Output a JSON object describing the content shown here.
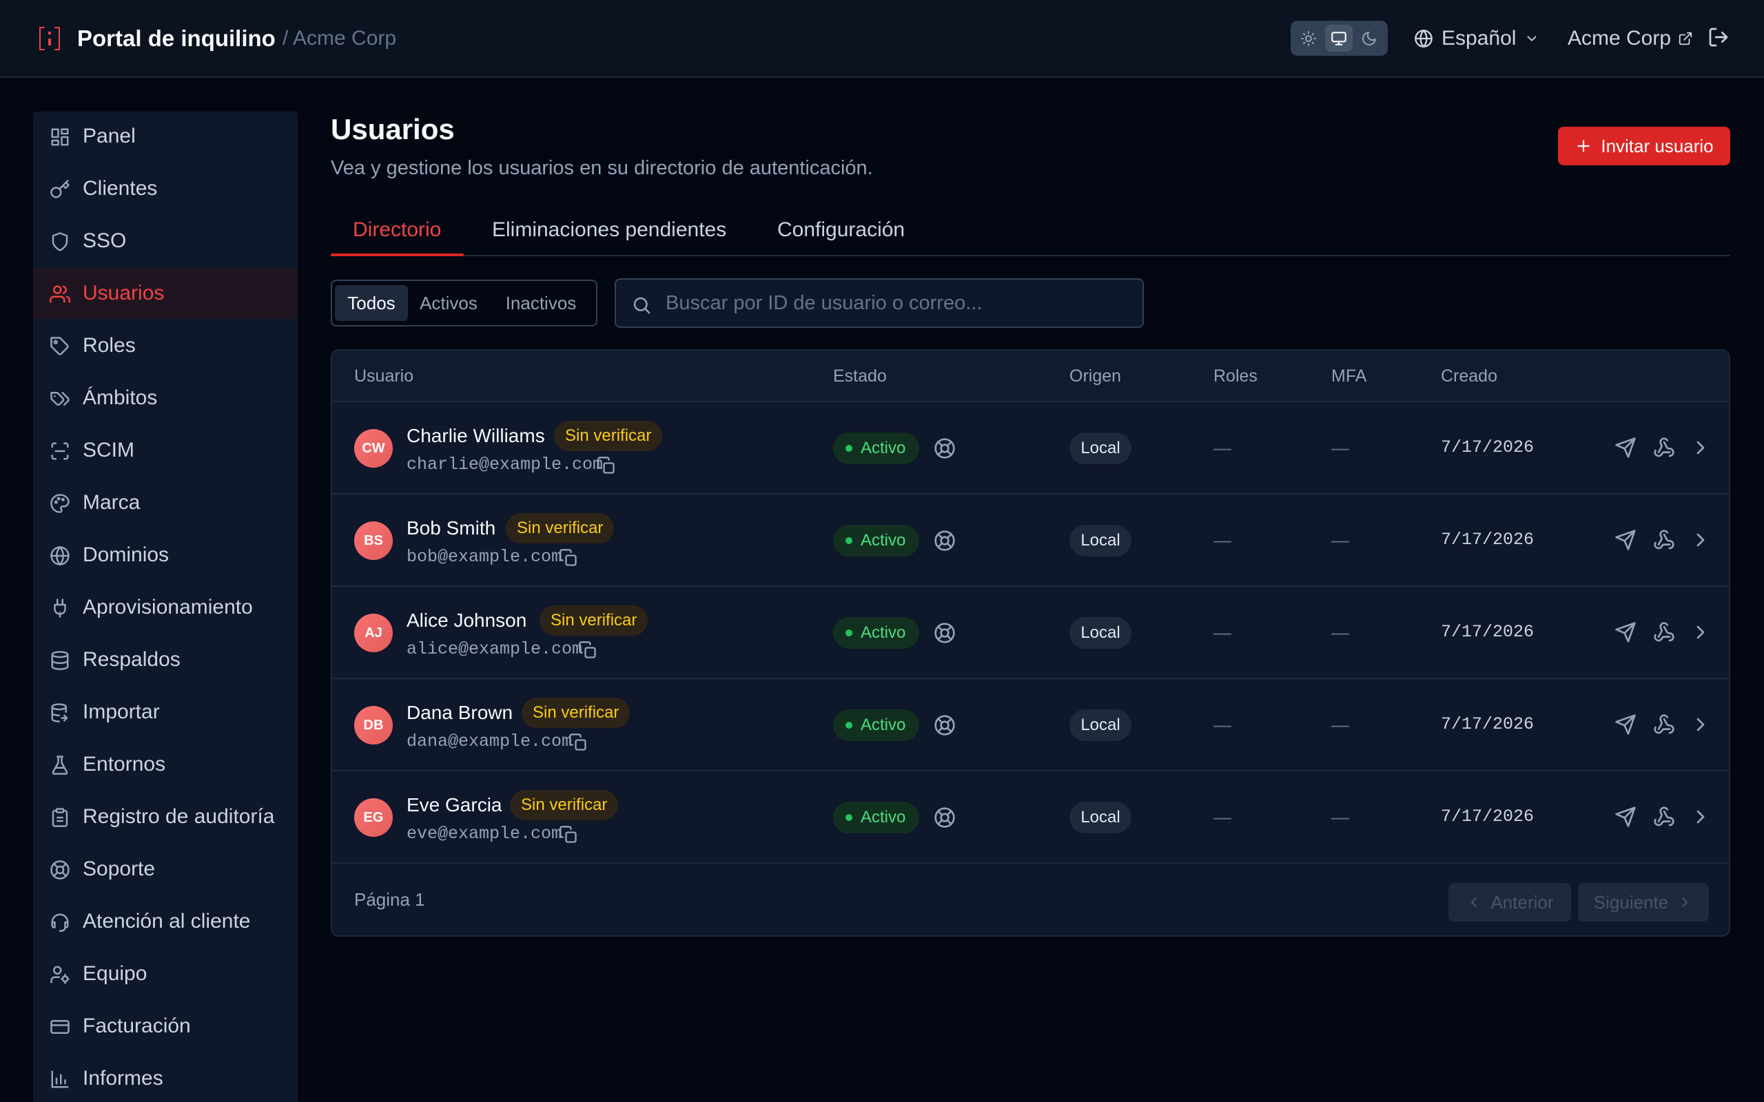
{
  "header": {
    "app_title": "Portal de inquilino",
    "breadcrumb": "/ Acme Corp",
    "theme_options": [
      "sun-icon",
      "monitor-icon",
      "moon-icon"
    ],
    "theme_selected": "monitor",
    "language": "Español",
    "org_link": "Acme Corp"
  },
  "sidebar": {
    "active": "Usuarios",
    "items": [
      {
        "label": "Panel",
        "icon": "dashboard-icon"
      },
      {
        "label": "Clientes",
        "icon": "key-icon"
      },
      {
        "label": "SSO",
        "icon": "shield-icon"
      },
      {
        "label": "Usuarios",
        "icon": "users-icon"
      },
      {
        "label": "Roles",
        "icon": "tag-icon"
      },
      {
        "label": "Ámbitos",
        "icon": "tags-icon"
      },
      {
        "label": "SCIM",
        "icon": "scan-icon"
      },
      {
        "label": "Marca",
        "icon": "palette-icon"
      },
      {
        "label": "Dominios",
        "icon": "globe-icon"
      },
      {
        "label": "Aprovisionamiento",
        "icon": "plug-icon"
      },
      {
        "label": "Respaldos",
        "icon": "database-icon"
      },
      {
        "label": "Importar",
        "icon": "database-import-icon"
      },
      {
        "label": "Entornos",
        "icon": "flask-icon"
      },
      {
        "label": "Registro de auditoría",
        "icon": "clipboard-icon"
      },
      {
        "label": "Soporte",
        "icon": "lifebuoy-icon"
      },
      {
        "label": "Atención al cliente",
        "icon": "headset-icon"
      },
      {
        "label": "Equipo",
        "icon": "user-cog-icon"
      },
      {
        "label": "Facturación",
        "icon": "credit-card-icon"
      },
      {
        "label": "Informes",
        "icon": "bar-chart-icon"
      }
    ]
  },
  "main": {
    "title": "Usuarios",
    "subtitle": "Vea y gestione los usuarios en su directorio de autenticación.",
    "invite_label": "Invitar usuario",
    "tabs": [
      {
        "label": "Directorio",
        "active": true
      },
      {
        "label": "Eliminaciones pendientes",
        "active": false
      },
      {
        "label": "Configuración",
        "active": false
      }
    ],
    "filters": [
      {
        "label": "Todos",
        "active": true
      },
      {
        "label": "Activos",
        "active": false
      },
      {
        "label": "Inactivos",
        "active": false
      }
    ],
    "search_placeholder": "Buscar por ID de usuario o correo...",
    "search_value": "",
    "table": {
      "columns": [
        "Usuario",
        "Estado",
        "Origen",
        "Roles",
        "MFA",
        "Creado"
      ],
      "rows": [
        {
          "initials": "CW",
          "name": "Charlie Williams",
          "badge": "Sin verificar",
          "email": "charlie@example.com",
          "status": "Activo",
          "origin": "Local",
          "roles": "—",
          "mfa": "—",
          "created": "7/17/2026"
        },
        {
          "initials": "BS",
          "name": "Bob Smith",
          "badge": "Sin verificar",
          "email": "bob@example.com",
          "status": "Activo",
          "origin": "Local",
          "roles": "—",
          "mfa": "—",
          "created": "7/17/2026"
        },
        {
          "initials": "AJ",
          "name": "Alice Johnson",
          "badge": "Sin verificar",
          "email": "alice@example.com",
          "status": "Activo",
          "origin": "Local",
          "roles": "—",
          "mfa": "—",
          "created": "7/17/2026"
        },
        {
          "initials": "DB",
          "name": "Dana Brown",
          "badge": "Sin verificar",
          "email": "dana@example.com",
          "status": "Activo",
          "origin": "Local",
          "roles": "—",
          "mfa": "—",
          "created": "7/17/2026"
        },
        {
          "initials": "EG",
          "name": "Eve Garcia",
          "badge": "Sin verificar",
          "email": "eve@example.com",
          "status": "Activo",
          "origin": "Local",
          "roles": "—",
          "mfa": "—",
          "created": "7/17/2026"
        }
      ],
      "row_actions": [
        "send-icon",
        "webhook-icon",
        "chevron-right-icon"
      ]
    },
    "pagination": {
      "page_label": "Página 1",
      "prev_label": "Anterior",
      "next_label": "Siguiente"
    }
  },
  "colors": {
    "accent": "#dc2626",
    "background": "#030712",
    "surface": "#0f172a",
    "success": "#22c55e",
    "warning": "#facc15"
  }
}
